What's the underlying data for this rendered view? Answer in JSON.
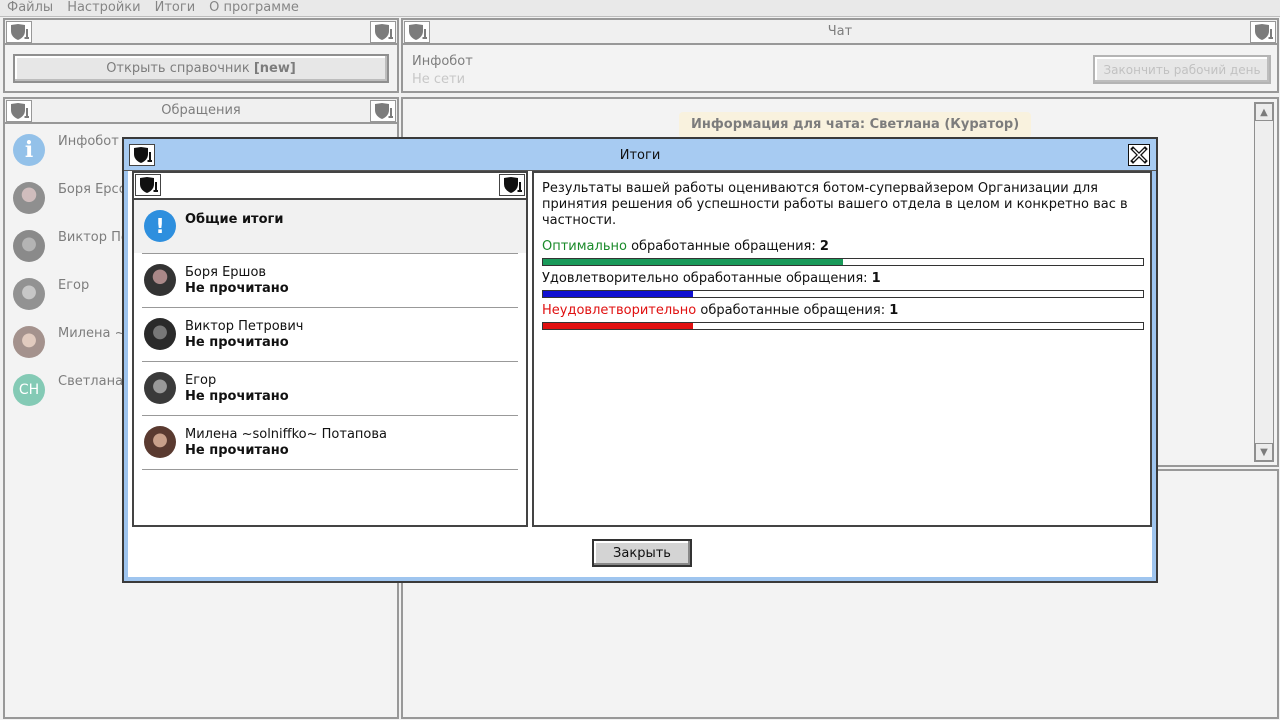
{
  "menu": [
    "Файлы",
    "Настройки",
    "Итоги",
    "О программе"
  ],
  "left_top": {
    "open_ref_label": "Открыть справочник ",
    "open_ref_tag": "[new]"
  },
  "chat": {
    "title": "Чат",
    "bot_name": "Инфобот",
    "bot_status": "Не сети",
    "end_day_label": "Закончить рабочий день",
    "info_badge": "Информация для чата: Светлана (Куратор)"
  },
  "requests": {
    "title": "Обращения",
    "items": [
      {
        "name": "Инфобот",
        "avatar": "info-icon"
      },
      {
        "name": "Боря Ерсо",
        "avatar": "photo"
      },
      {
        "name": "Виктор Пе",
        "avatar": "photo"
      },
      {
        "name": "Егор",
        "avatar": "photo"
      },
      {
        "name": "Милена ~s",
        "avatar": "photo"
      },
      {
        "name": "Светлана",
        "avatar": "СН"
      }
    ]
  },
  "dialog": {
    "title": "Итоги",
    "summary_label": "Общие итоги",
    "people": [
      {
        "name": "Боря Ершов",
        "status": "Не прочитано"
      },
      {
        "name": "Виктор Петрович",
        "status": "Не прочитано"
      },
      {
        "name": "Егор",
        "status": "Не прочитано"
      },
      {
        "name": "Милена ~solniffko~ Потапова",
        "status": "Не прочитано"
      }
    ],
    "intro": "Результаты вашей работы оцениваются ботом-супервайзером Организации для принятия решения об успешности работы вашего отдела в целом и конкретно вас в частности.",
    "metrics": [
      {
        "word": "Оптимально",
        "rest": " обработанные обращения: ",
        "value": "2",
        "word_color": "#1a8a2a",
        "bar_color": "#1a9a5a",
        "fraction": 0.5
      },
      {
        "word": "",
        "rest": "Удовлетворительно обработанные обращения: ",
        "value": "1",
        "word_color": "#111111",
        "bar_color": "#1010d0",
        "fraction": 0.25
      },
      {
        "word": "Неудовлетворительно",
        "rest": " обработанные обращения: ",
        "value": "1",
        "word_color": "#e01010",
        "bar_color": "#e01010",
        "fraction": 0.25
      }
    ],
    "close_label": "Закрыть"
  }
}
